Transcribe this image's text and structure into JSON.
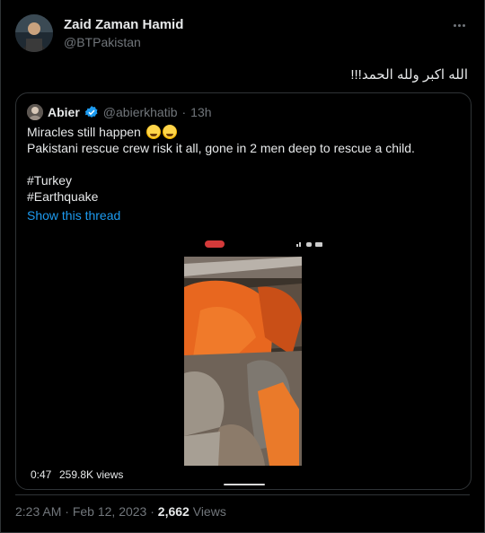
{
  "author": {
    "name": "Zaid Zaman Hamid",
    "handle": "@BTPakistan"
  },
  "tweet": {
    "text": "الله اکبر ولله الحمد!!!"
  },
  "quote": {
    "name": "Abier",
    "handle": "@abierkhatib",
    "dot": "·",
    "age": "13h",
    "line1": "Miracles still happen",
    "line2": "Pakistani rescue crew risk it all, gone in 2 men deep to rescue a child.",
    "tag1": "#Turkey",
    "tag2": "#Earthquake",
    "show_thread": "Show this thread",
    "video": {
      "duration": "0:47",
      "views": "259.8K views"
    }
  },
  "footer": {
    "time": "2:23 AM",
    "sep": "·",
    "date": "Feb 12, 2023",
    "sep2": "·",
    "views_count": "2,662",
    "views_label": "Views"
  },
  "colors": {
    "accent": "#1d9bf0",
    "background": "#000000",
    "muted": "#71767b"
  },
  "icons": {
    "more": "more-icon",
    "verified": "verified-badge-icon",
    "emoji": "loudly-crying-face-emoji-icon"
  }
}
